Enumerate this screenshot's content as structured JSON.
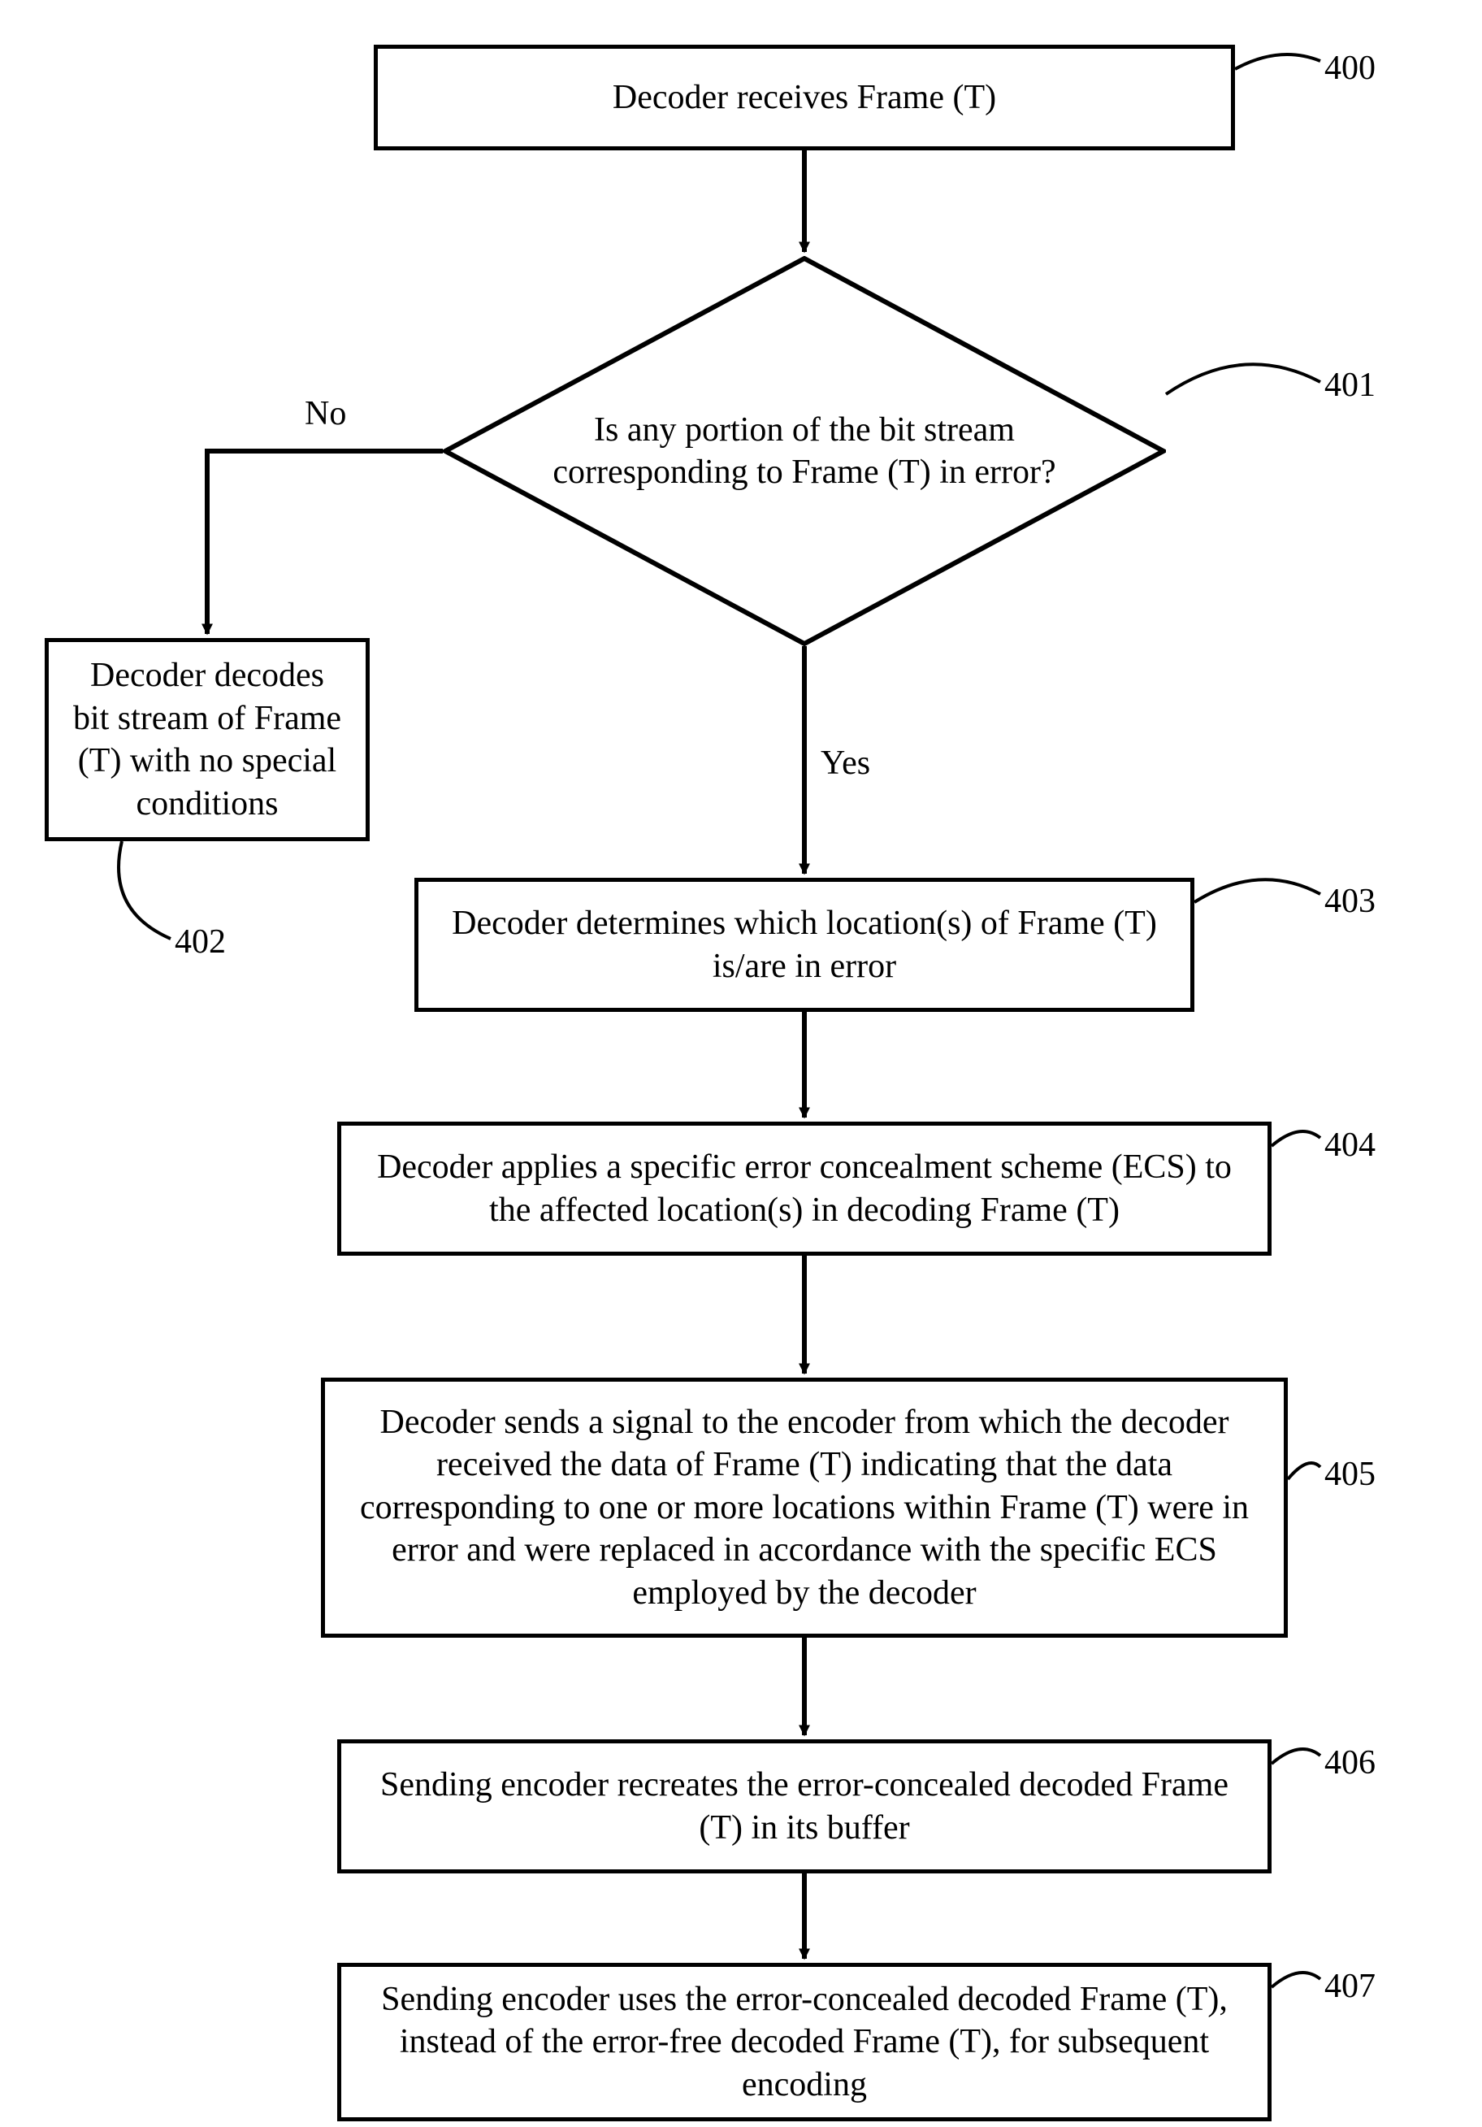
{
  "nodes": {
    "n400": {
      "text": "Decoder receives Frame (T)",
      "ref": "400"
    },
    "n401": {
      "text": "Is any portion of the bit stream corresponding to Frame (T) in error?",
      "ref": "401"
    },
    "n402": {
      "text": "Decoder decodes bit stream of Frame (T) with no special conditions",
      "ref": "402"
    },
    "n403": {
      "text": "Decoder determines which location(s) of Frame (T) is/are in error",
      "ref": "403"
    },
    "n404": {
      "text": "Decoder applies a specific error concealment scheme (ECS) to the affected location(s) in decoding Frame (T)",
      "ref": "404"
    },
    "n405": {
      "text": "Decoder sends a signal to the encoder from which the decoder received the data of Frame (T) indicating that the data corresponding to one or more locations within Frame (T) were in error and were replaced in accordance with the specific ECS employed by the decoder",
      "ref": "405"
    },
    "n406": {
      "text": "Sending encoder recreates the error-concealed decoded Frame (T) in its buffer",
      "ref": "406"
    },
    "n407": {
      "text": "Sending encoder uses the error-concealed decoded Frame (T), instead of the error-free decoded Frame (T), for subsequent encoding",
      "ref": "407"
    }
  },
  "edges": {
    "no": "No",
    "yes": "Yes"
  }
}
